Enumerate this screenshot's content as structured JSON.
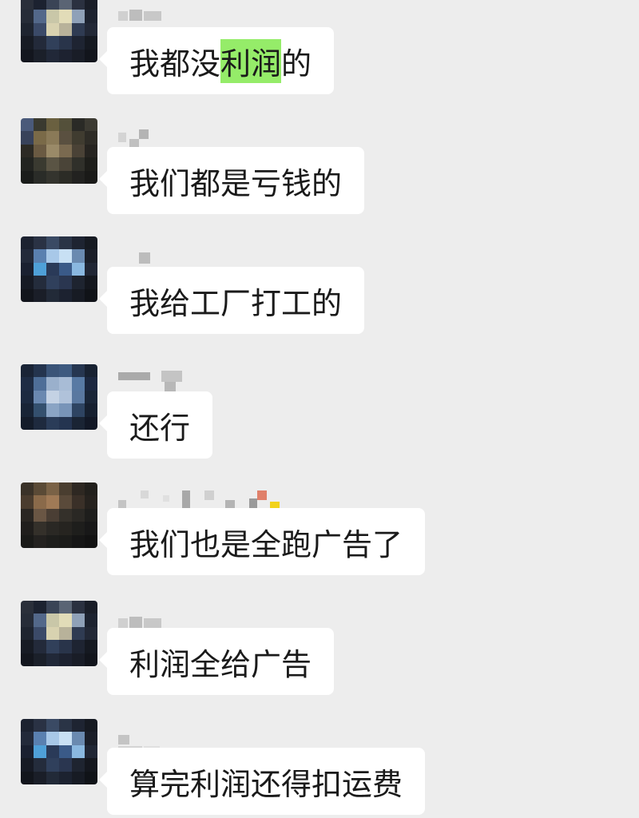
{
  "colors": {
    "background": "#ededed",
    "bubble": "#ffffff",
    "highlight": "#95ec69",
    "text": "#1a1a1a"
  },
  "messages": [
    {
      "text_before": "我都没",
      "highlight": "利润",
      "text_after": "的"
    },
    {
      "text": "我们都是亏钱的"
    },
    {
      "text": "我给工厂打工的"
    },
    {
      "text": "还行"
    },
    {
      "text": "我们也是全跑广告了"
    },
    {
      "text": "利润全给广告"
    },
    {
      "text": "算完利润还得扣运费"
    }
  ]
}
